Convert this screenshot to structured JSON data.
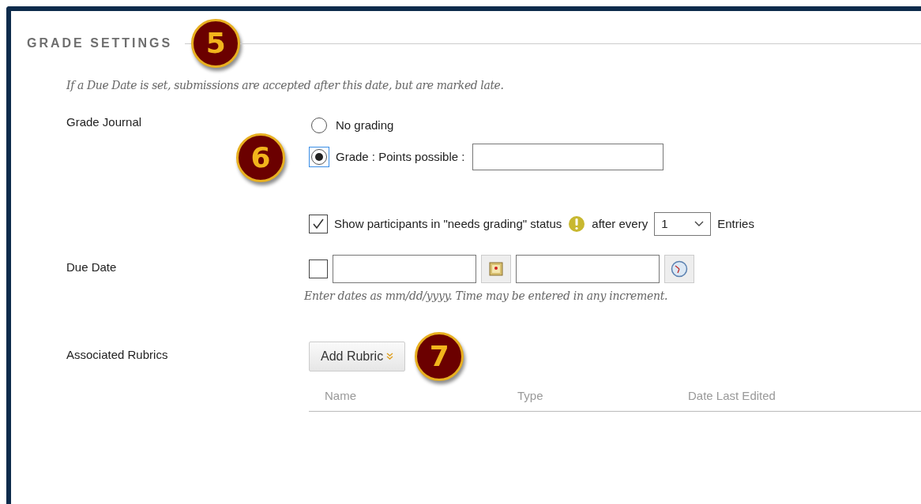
{
  "section": {
    "title": "GRADE SETTINGS",
    "step": "5"
  },
  "note": "If a Due Date is set, submissions are accepted after this date, but are marked late.",
  "grade_journal": {
    "label": "Grade Journal",
    "step": "6",
    "options": [
      {
        "label": "No grading",
        "selected": false,
        "kind": "plain"
      },
      {
        "label": "Grade : Points possible :",
        "selected": true,
        "kind": "points"
      }
    ],
    "needs_grading": {
      "checked": true,
      "label": "Show participants in \"needs grading\" status",
      "after": "after every",
      "count": "1",
      "unit": "Entries"
    }
  },
  "due_date": {
    "label": "Due Date",
    "checked": false,
    "hint": "Enter dates as mm/dd/yyyy. Time may be entered in any increment."
  },
  "rubrics": {
    "label": "Associated Rubrics",
    "button": "Add Rubric",
    "step": "7",
    "columns": [
      "Name",
      "Type",
      "Date Last Edited"
    ]
  }
}
